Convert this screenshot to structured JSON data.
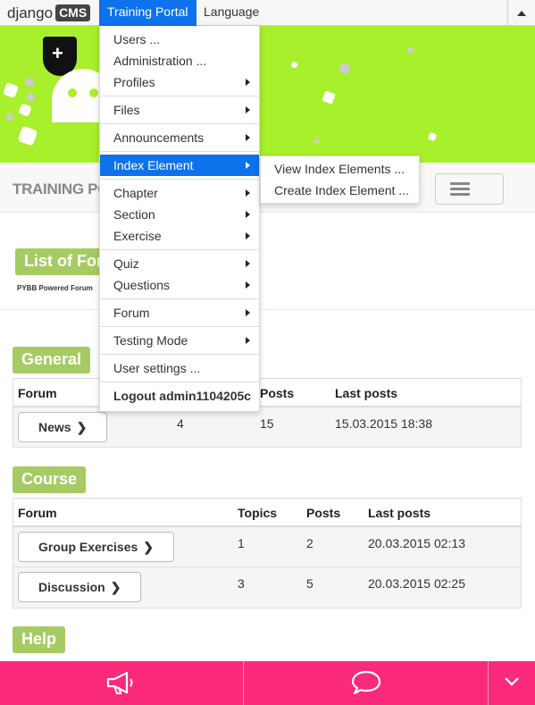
{
  "toolbar": {
    "logo_text": "django",
    "logo_badge": "CMS",
    "items": [
      {
        "label": "Training Portal",
        "active": true
      },
      {
        "label": "Language",
        "active": false
      }
    ],
    "collapse_icon": "caret-up-icon"
  },
  "header": {
    "site_title": "TRAINING PORT",
    "menu_icon": "hamburger-icon"
  },
  "dropdown": {
    "groups": [
      [
        {
          "label": "Users ...",
          "submenu": false
        },
        {
          "label": "Administration ...",
          "submenu": false
        },
        {
          "label": "Profiles",
          "submenu": true
        }
      ],
      [
        {
          "label": "Files",
          "submenu": true
        }
      ],
      [
        {
          "label": "Announcements",
          "submenu": true
        }
      ],
      [
        {
          "label": "Index Element",
          "submenu": true,
          "highlighted": true
        }
      ],
      [
        {
          "label": "Chapter",
          "submenu": true
        },
        {
          "label": "Section",
          "submenu": true
        },
        {
          "label": "Exercise",
          "submenu": true
        }
      ],
      [
        {
          "label": "Quiz",
          "submenu": true
        },
        {
          "label": "Questions",
          "submenu": true
        }
      ],
      [
        {
          "label": "Forum",
          "submenu": true
        }
      ],
      [
        {
          "label": "Testing Mode",
          "submenu": true
        }
      ],
      [
        {
          "label": "User settings ...",
          "submenu": false
        }
      ],
      [
        {
          "label": "Logout admin1104205c",
          "submenu": false,
          "bold": true
        }
      ]
    ],
    "submenu_items": [
      "View Index Elements ...",
      "Create Index Element ..."
    ]
  },
  "content": {
    "list_title": "List of Foru",
    "powered_by": "PYBB Powered Forum",
    "sections": [
      {
        "label": "General",
        "columns": [
          "Forum",
          "",
          "Posts",
          "Last posts"
        ],
        "rows": [
          {
            "forum": "News",
            "topics": "4",
            "posts": "15",
            "last": "15.03.2015 18:38"
          }
        ]
      },
      {
        "label": "Course",
        "columns": [
          "Forum",
          "Topics",
          "Posts",
          "Last posts"
        ],
        "rows": [
          {
            "forum": "Group Exercises",
            "topics": "1",
            "posts": "2",
            "last": "20.03.2015 02:13"
          },
          {
            "forum": "Discussion",
            "topics": "3",
            "posts": "5",
            "last": "20.03.2015 02:25"
          }
        ]
      },
      {
        "label": "Help"
      }
    ]
  },
  "bottom_bar": {
    "icons": [
      "megaphone-icon",
      "speech-bubble-icon",
      "chevron-down-icon"
    ]
  },
  "colors": {
    "toolbar_active": "#0e72ec",
    "banner": "#a8ef2c",
    "label_green": "#a6cb63",
    "bottom_bar": "#fb2a7a"
  }
}
